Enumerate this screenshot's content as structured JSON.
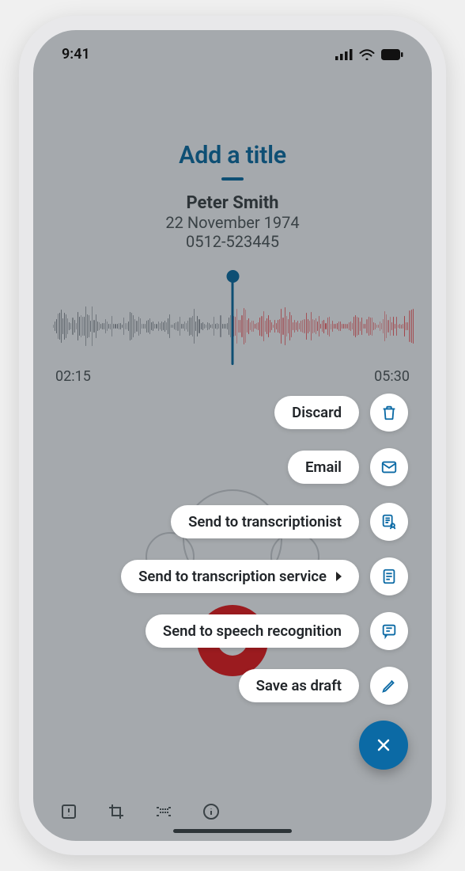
{
  "status": {
    "time": "9:41"
  },
  "header": {
    "title_placeholder": "Add a title",
    "patient_name": "Peter Smith",
    "patient_date": "22 November 1974",
    "patient_id": "0512-523445"
  },
  "times": {
    "current": "02:15",
    "total": "05:30"
  },
  "menu": {
    "items": [
      {
        "label": "Discard",
        "icon": "trash-icon"
      },
      {
        "label": "Email",
        "icon": "mail-icon"
      },
      {
        "label": "Send to transcriptionist",
        "icon": "person-doc-icon"
      },
      {
        "label": "Send to transcription service",
        "icon": "document-icon",
        "has_submenu": true
      },
      {
        "label": "Send to speech recognition",
        "icon": "speech-icon"
      },
      {
        "label": "Save as draft",
        "icon": "pencil-icon"
      }
    ]
  },
  "colors": {
    "accent": "#0b6aa5",
    "accent_dark": "#0e4f74",
    "record": "#9b1b1f",
    "wave_past": "#5a6168",
    "wave_future": "#a2454a",
    "bg": "#a5a9ad"
  }
}
